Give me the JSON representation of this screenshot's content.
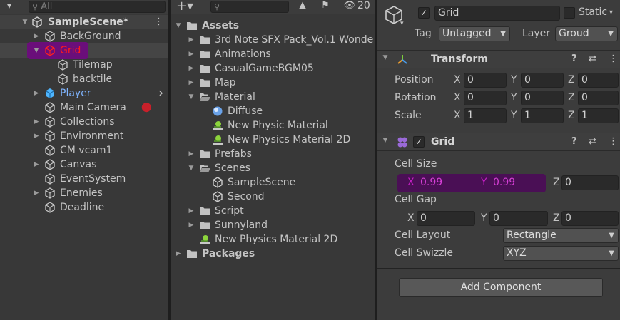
{
  "hierarchy": {
    "search_placeholder": "All",
    "scene_name": "SampleScene*",
    "items": [
      {
        "label": "BackGround",
        "arrow": "▶"
      },
      {
        "label": "Grid",
        "arrow": "▼"
      },
      {
        "label": "Tilemap",
        "arrow": ""
      },
      {
        "label": "backtile",
        "arrow": ""
      },
      {
        "label": "Player",
        "arrow": "▶"
      },
      {
        "label": "Main Camera",
        "arrow": ""
      },
      {
        "label": "Collections",
        "arrow": "▶"
      },
      {
        "label": "Environment",
        "arrow": "▶"
      },
      {
        "label": "CM vcam1",
        "arrow": ""
      },
      {
        "label": "Canvas",
        "arrow": "▶"
      },
      {
        "label": "EventSystem",
        "arrow": ""
      },
      {
        "label": "Enemies",
        "arrow": "▶"
      },
      {
        "label": "Deadline",
        "arrow": ""
      }
    ]
  },
  "project": {
    "hidden_count": "20",
    "items": [
      {
        "label": "Assets",
        "arrow": "▼",
        "kind": "folder"
      },
      {
        "label": "3rd Note SFX Pack_Vol.1 Wonde",
        "arrow": "▶",
        "kind": "folder"
      },
      {
        "label": "Animations",
        "arrow": "▶",
        "kind": "folder"
      },
      {
        "label": "CasualGameBGM05",
        "arrow": "▶",
        "kind": "folder"
      },
      {
        "label": "Map",
        "arrow": "▶",
        "kind": "folder"
      },
      {
        "label": "Material",
        "arrow": "▼",
        "kind": "folder-open"
      },
      {
        "label": "Diffuse",
        "arrow": "",
        "kind": "material"
      },
      {
        "label": "New Physic Material",
        "arrow": "",
        "kind": "physic"
      },
      {
        "label": "New Physics Material 2D",
        "arrow": "",
        "kind": "physic"
      },
      {
        "label": "Prefabs",
        "arrow": "▶",
        "kind": "folder"
      },
      {
        "label": "Scenes",
        "arrow": "▼",
        "kind": "folder-open"
      },
      {
        "label": "SampleScene",
        "arrow": "",
        "kind": "unity"
      },
      {
        "label": "Second",
        "arrow": "",
        "kind": "unity"
      },
      {
        "label": "Script",
        "arrow": "▶",
        "kind": "folder"
      },
      {
        "label": "Sunnyland",
        "arrow": "▶",
        "kind": "folder"
      },
      {
        "label": "New Physics Material 2D",
        "arrow": "",
        "kind": "physic"
      },
      {
        "label": "Packages",
        "arrow": "▶",
        "kind": "folder"
      }
    ]
  },
  "inspector": {
    "object_name": "Grid",
    "static_label": "Static",
    "tag_label": "Tag",
    "tag_value": "Untagged",
    "layer_label": "Layer",
    "layer_value": "Groud",
    "transform": {
      "title": "Transform",
      "rows": [
        {
          "label": "Position",
          "x": "0",
          "y": "0",
          "z": "0"
        },
        {
          "label": "Rotation",
          "x": "0",
          "y": "0",
          "z": "0"
        },
        {
          "label": "Scale",
          "x": "1",
          "y": "1",
          "z": "1"
        }
      ]
    },
    "grid": {
      "title": "Grid",
      "cell_size_label": "Cell Size",
      "cell_size": {
        "x": "0.99",
        "y": "0.99",
        "z": "0"
      },
      "cell_gap_label": "Cell Gap",
      "cell_gap": {
        "x": "0",
        "y": "0",
        "z": "0"
      },
      "cell_layout_label": "Cell Layout",
      "cell_layout_value": "Rectangle",
      "cell_swizzle_label": "Cell Swizzle",
      "cell_swizzle_value": "XYZ"
    },
    "add_component_label": "Add Component",
    "axis_x": "X",
    "axis_y": "Y",
    "axis_z": "Z"
  },
  "colors": {
    "selection": "#6a0e7a",
    "grid_highlight": "#ff1a1a",
    "player_blue": "#7fb4ff",
    "annotation_purple": "#c41fc4"
  }
}
